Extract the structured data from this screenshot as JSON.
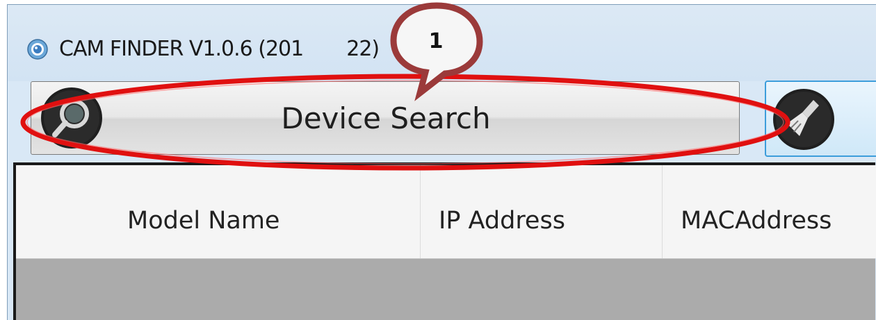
{
  "window": {
    "title": "CAM FINDER V1.0.6 (201",
    "title_suffix": "22)"
  },
  "toolbar": {
    "device_search_label": "Device Search",
    "search_icon": "magnifier-icon",
    "clear_icon": "broom-icon"
  },
  "table": {
    "columns": [
      "Model Name",
      "IP Address",
      "MACAddress"
    ]
  },
  "annotation": {
    "step_number": "1",
    "highlight_color": "#e01010",
    "callout_color": "#9b3a3a"
  }
}
